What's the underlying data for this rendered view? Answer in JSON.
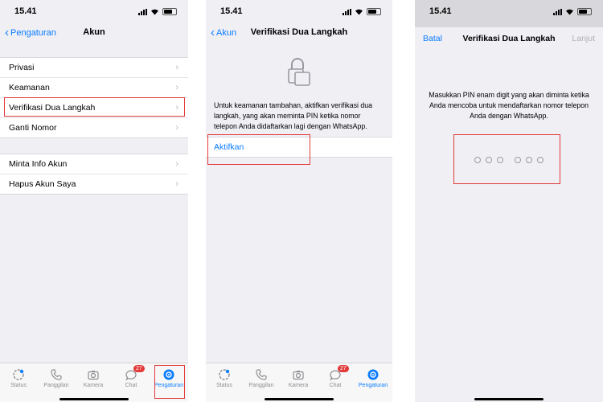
{
  "status_time": "15.41",
  "screen1": {
    "back_label": "Pengaturan",
    "title": "Akun",
    "group1": [
      "Privasi",
      "Keamanan",
      "Verifikasi Dua Langkah",
      "Ganti Nomor"
    ],
    "group2": [
      "Minta Info Akun",
      "Hapus Akun Saya"
    ]
  },
  "screen2": {
    "back_label": "Akun",
    "title": "Verifikasi Dua Langkah",
    "description": "Untuk keamanan tambahan, aktifkan verifikasi dua langkah, yang akan meminta PIN ketika nomor telepon Anda didaftarkan lagi dengan WhatsApp.",
    "action_label": "Aktifkan"
  },
  "screen3": {
    "cancel_label": "Batal",
    "title": "Verifikasi Dua Langkah",
    "next_label": "Lanjut",
    "message": "Masukkan PIN enam digit yang akan diminta ketika Anda mencoba untuk mendaftarkan nomor telepon Anda dengan WhatsApp."
  },
  "tabbar": {
    "tabs": [
      "Status",
      "Panggilan",
      "Kamera",
      "Chat",
      "Pengaturan"
    ],
    "chat_badge": "27",
    "icons": [
      "status-icon",
      "phone-icon",
      "camera-icon",
      "chat-icon",
      "settings-icon"
    ]
  },
  "colors": {
    "accent": "#0a7cff",
    "highlight": "#e23a3a",
    "background": "#efeff4"
  }
}
